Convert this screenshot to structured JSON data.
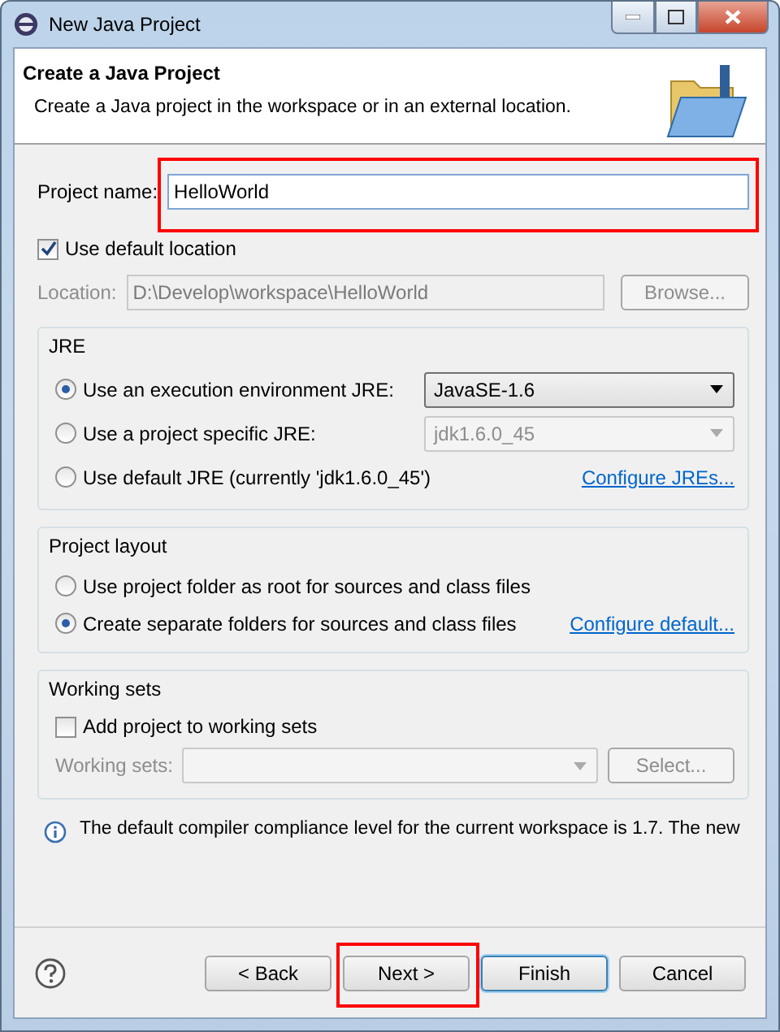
{
  "window": {
    "title": "New Java Project"
  },
  "header": {
    "title": "Create a Java Project",
    "description": "Create a Java project in the workspace or in an external location."
  },
  "project_name": {
    "label": "Project name:",
    "value": "HelloWorld",
    "highlighted": true
  },
  "default_location": {
    "label": "Use default location",
    "checked": true
  },
  "location": {
    "label": "Location:",
    "value": "D:\\Develop\\workspace\\HelloWorld",
    "button": "Browse..."
  },
  "jre": {
    "title": "JRE",
    "options": [
      {
        "label": "Use an execution environment JRE:",
        "selected": true,
        "combo": "JavaSE-1.6"
      },
      {
        "label": "Use a project specific JRE:",
        "selected": false,
        "combo": "jdk1.6.0_45"
      },
      {
        "label": "Use default JRE (currently 'jdk1.6.0_45')",
        "selected": false,
        "link": "Configure JREs..."
      }
    ]
  },
  "project_layout": {
    "title": "Project layout",
    "options": [
      {
        "label": "Use project folder as root for sources and class files",
        "selected": false
      },
      {
        "label": "Create separate folders for sources and class files",
        "selected": true,
        "link": "Configure default..."
      }
    ]
  },
  "working_sets": {
    "title": "Working sets",
    "add": {
      "label": "Add project to working sets",
      "checked": false
    },
    "field_label": "Working sets:",
    "button": "Select..."
  },
  "message": "The default compiler compliance level for the current workspace is 1.7. The new",
  "buttons": [
    {
      "label": "< Back",
      "default": false,
      "highlighted": false
    },
    {
      "label": "Next >",
      "default": false,
      "highlighted": true
    },
    {
      "label": "Finish",
      "default": true,
      "highlighted": false
    },
    {
      "label": "Cancel",
      "default": false,
      "highlighted": false
    }
  ]
}
